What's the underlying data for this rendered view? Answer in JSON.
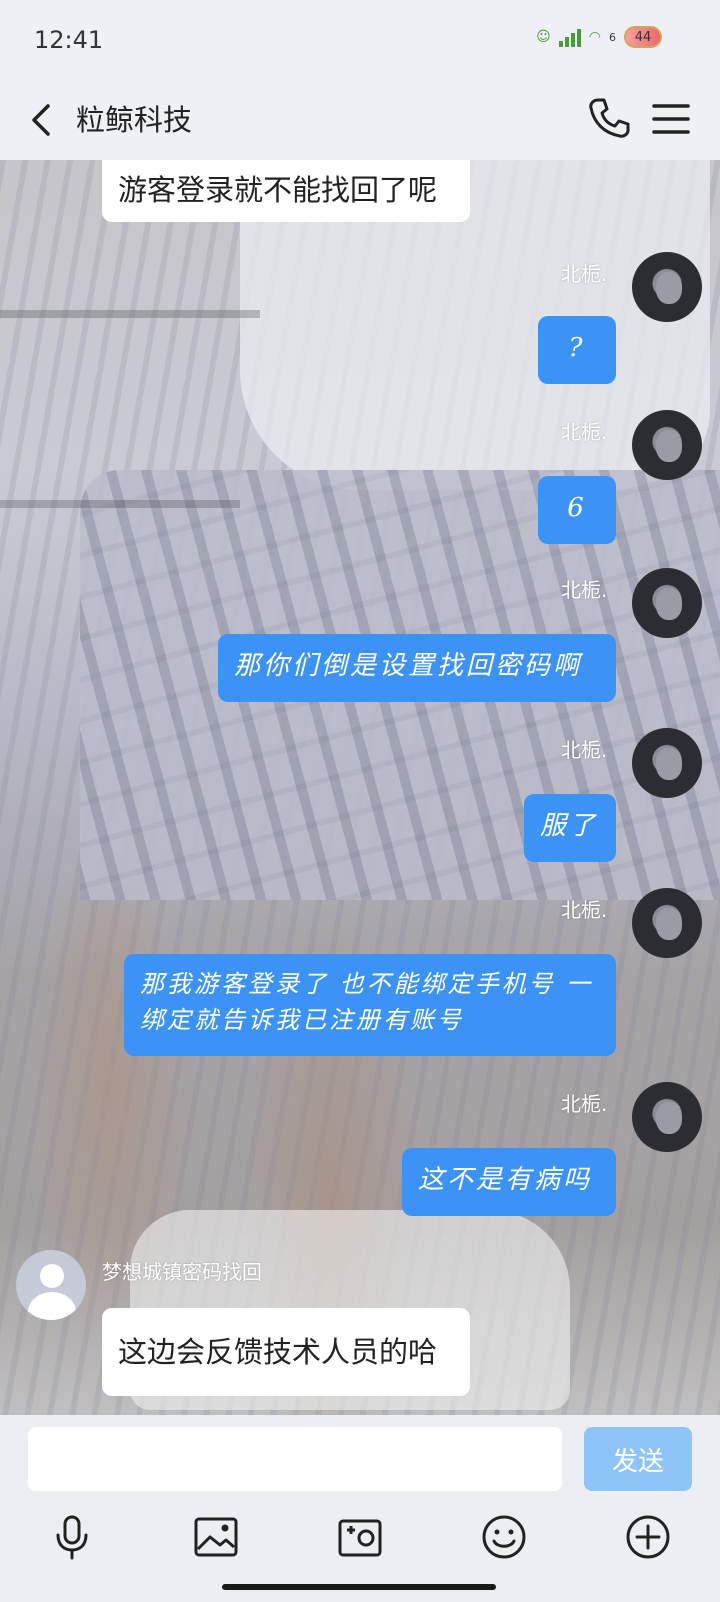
{
  "status_bar": {
    "time": "12:41",
    "network_small": "6",
    "battery": "44"
  },
  "header": {
    "title": "粒鲸科技",
    "icons": [
      "back-arrow-icon",
      "phone-icon",
      "menu-icon"
    ]
  },
  "messages": [
    {
      "side": "left",
      "text": "游客登录就不能找回了呢"
    },
    {
      "side": "right",
      "sender": "北栀.",
      "text": "?"
    },
    {
      "side": "right",
      "sender": "北栀.",
      "text": "6"
    },
    {
      "side": "right",
      "sender": "北栀.",
      "text": "那你们倒是设置找回密码啊"
    },
    {
      "side": "right",
      "sender": "北栀.",
      "text": "服了"
    },
    {
      "side": "right",
      "sender": "北栀.",
      "text": "那我游客登录了 也不能绑定手机号 一绑定就告诉我已注册有账号"
    },
    {
      "side": "right",
      "sender": "北栀.",
      "text": "这不是有病吗"
    },
    {
      "side": "left",
      "sender": "梦想城镇密码找回",
      "text": "这边会反馈技术人员的哈"
    }
  ],
  "input": {
    "value": "",
    "send_label": "发送"
  },
  "toolbar": {
    "icons": [
      "microphone-icon",
      "image-icon",
      "camera-icon",
      "emoji-icon",
      "plus-icon"
    ]
  },
  "colors": {
    "bubble_self": "#3d93f5",
    "bubble_other": "#ffffff",
    "send_button": "#8fc4f8",
    "bar_background": "#eceef3"
  }
}
